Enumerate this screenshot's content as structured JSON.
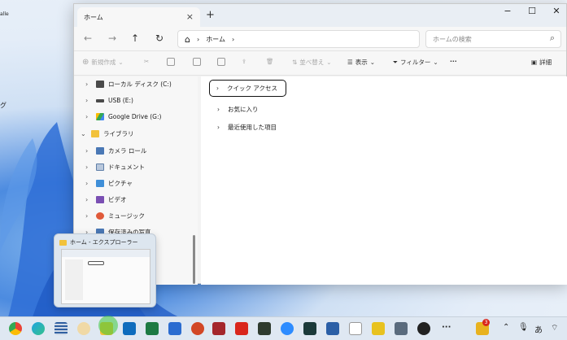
{
  "window": {
    "tab_title": "ホーム",
    "address_path": "ホーム",
    "search_placeholder": "ホームの検索"
  },
  "commands": {
    "new": "新規作成",
    "sort": "並べ替え",
    "view": "表示",
    "filter": "フィルター",
    "details": "詳細"
  },
  "tree": [
    {
      "label": "ローカル ディスク (C:)",
      "icon": "drive-icon",
      "color": "#4a4a4a"
    },
    {
      "label": "USB (E:)",
      "icon": "usb-drive-icon",
      "color": "#4a4a4a"
    },
    {
      "label": "Google Drive (G:)",
      "icon": "google-drive-icon",
      "color": "#34a853"
    },
    {
      "label": "ライブラリ",
      "icon": "library-folder-icon",
      "color": "#f2c23b"
    },
    {
      "label": "カメラ ロール",
      "icon": "camera-roll-icon",
      "color": "#4a78b5"
    },
    {
      "label": "ドキュメント",
      "icon": "documents-icon",
      "color": "#5f7fa8"
    },
    {
      "label": "ピクチャ",
      "icon": "pictures-icon",
      "color": "#3f8fd8"
    },
    {
      "label": "ビデオ",
      "icon": "videos-icon",
      "color": "#7a4fb3"
    },
    {
      "label": "ミュージック",
      "icon": "music-icon",
      "color": "#e05a3a"
    },
    {
      "label": "保存済みの写真",
      "icon": "saved-pictures-icon",
      "color": "#4a78b5"
    }
  ],
  "sections": [
    "クイック アクセス",
    "お気に入り",
    "最近使用した項目"
  ],
  "preview_title": "ホーム - エクスプローラー",
  "desktop_labels": [
    "alle",
    "グ"
  ],
  "tray": {
    "badge": "3",
    "ime": "あ"
  }
}
